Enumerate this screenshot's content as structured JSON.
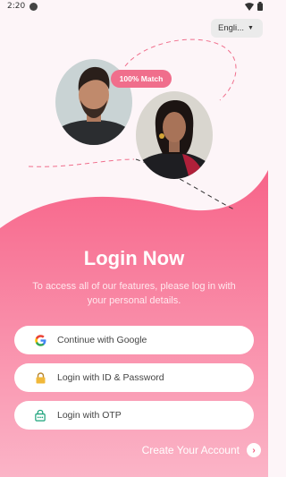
{
  "status_bar": {
    "time": "2:20"
  },
  "language": {
    "label": "Engli...",
    "chevron": "chevron-down-icon"
  },
  "hero": {
    "match_badge": "100% Match"
  },
  "login": {
    "title": "Login Now",
    "subtitle": "To access all of our features, please log in with your personal details."
  },
  "buttons": [
    {
      "label": "Continue with Google",
      "icon": "google-icon"
    },
    {
      "label": "Login with ID & Password",
      "icon": "lock-icon"
    },
    {
      "label": "Login with OTP",
      "icon": "otp-icon"
    }
  ],
  "footer": {
    "create_account": "Create Your Account"
  },
  "colors": {
    "accent": "#f0567a",
    "badge": "#f06e8c",
    "background": "#fdf5f8"
  }
}
